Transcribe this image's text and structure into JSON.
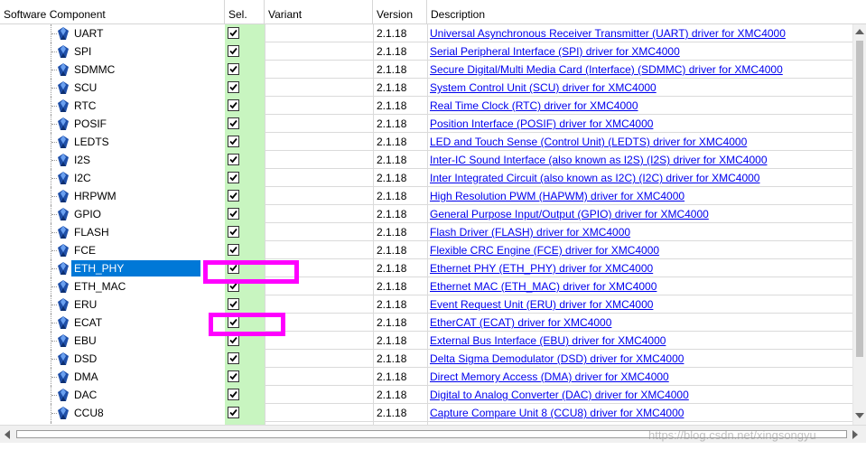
{
  "header": {
    "component": "Software Component",
    "sel": "Sel.",
    "variant": "Variant",
    "version": "Version",
    "description": "Description"
  },
  "rows": [
    {
      "name": "UART",
      "checked": true,
      "version": "2.1.18",
      "description": "Universal Asynchronous Receiver Transmitter (UART) driver for XMC4000"
    },
    {
      "name": "SPI",
      "checked": true,
      "version": "2.1.18",
      "description": "Serial Peripheral Interface (SPI) driver for XMC4000"
    },
    {
      "name": "SDMMC",
      "checked": true,
      "version": "2.1.18",
      "description": "Secure Digital/Multi Media Card (Interface) (SDMMC) driver for XMC4000"
    },
    {
      "name": "SCU",
      "checked": true,
      "version": "2.1.18",
      "description": "System Control Unit (SCU) driver for XMC4000"
    },
    {
      "name": "RTC",
      "checked": true,
      "version": "2.1.18",
      "description": "Real Time Clock (RTC) driver for XMC4000"
    },
    {
      "name": "POSIF",
      "checked": true,
      "version": "2.1.18",
      "description": "Position Interface (POSIF) driver for XMC4000"
    },
    {
      "name": "LEDTS",
      "checked": true,
      "version": "2.1.18",
      "description": "LED and Touch Sense (Control Unit) (LEDTS) driver for XMC4000"
    },
    {
      "name": "I2S",
      "checked": true,
      "version": "2.1.18",
      "description": "Inter-IC Sound Interface (also known as I2S) (I2S) driver for XMC4000"
    },
    {
      "name": "I2C",
      "checked": true,
      "version": "2.1.18",
      "description": "Inter Integrated Circuit (also known as I2C) (I2C) driver for XMC4000"
    },
    {
      "name": "HRPWM",
      "checked": true,
      "version": "2.1.18",
      "description": "High Resolution PWM (HAPWM) driver for XMC4000"
    },
    {
      "name": "GPIO",
      "checked": true,
      "version": "2.1.18",
      "description": "General Purpose Input/Output (GPIO) driver for XMC4000"
    },
    {
      "name": "FLASH",
      "checked": true,
      "version": "2.1.18",
      "description": "Flash Driver (FLASH) driver for XMC4000"
    },
    {
      "name": "FCE",
      "checked": true,
      "version": "2.1.18",
      "description": "Flexible CRC Engine (FCE) driver for XMC4000"
    },
    {
      "name": "ETH_PHY",
      "checked": true,
      "version": "2.1.18",
      "description": "Ethernet PHY (ETH_PHY) driver for XMC4000",
      "selected": true
    },
    {
      "name": "ETH_MAC",
      "checked": true,
      "version": "2.1.18",
      "description": "Ethernet MAC (ETH_MAC) driver for XMC4000"
    },
    {
      "name": "ERU",
      "checked": true,
      "version": "2.1.18",
      "description": "Event Request Unit (ERU) driver for XMC4000"
    },
    {
      "name": "ECAT",
      "checked": true,
      "version": "2.1.18",
      "description": "EtherCAT (ECAT) driver for XMC4000"
    },
    {
      "name": "EBU",
      "checked": true,
      "version": "2.1.18",
      "description": "External Bus Interface (EBU) driver for XMC4000"
    },
    {
      "name": "DSD",
      "checked": true,
      "version": "2.1.18",
      "description": "Delta Sigma Demodulator (DSD) driver for XMC4000"
    },
    {
      "name": "DMA",
      "checked": true,
      "version": "2.1.18",
      "description": "Direct Memory Access (DMA) driver for XMC4000"
    },
    {
      "name": "DAC",
      "checked": true,
      "version": "2.1.18",
      "description": "Digital to Analog Converter (DAC) driver for XMC4000"
    },
    {
      "name": "CCU8",
      "checked": true,
      "version": "2.1.18",
      "description": "Capture Compare Unit 8 (CCU8) driver for XMC4000"
    },
    {
      "name": "",
      "checked": true,
      "version": "",
      "description": ""
    }
  ],
  "annotation_color": "#ff00ff",
  "selection_color": "#0078d7",
  "sel_column_color": "#c8f5c0",
  "watermark": "https://blog.csdn.net/xingsongyu"
}
